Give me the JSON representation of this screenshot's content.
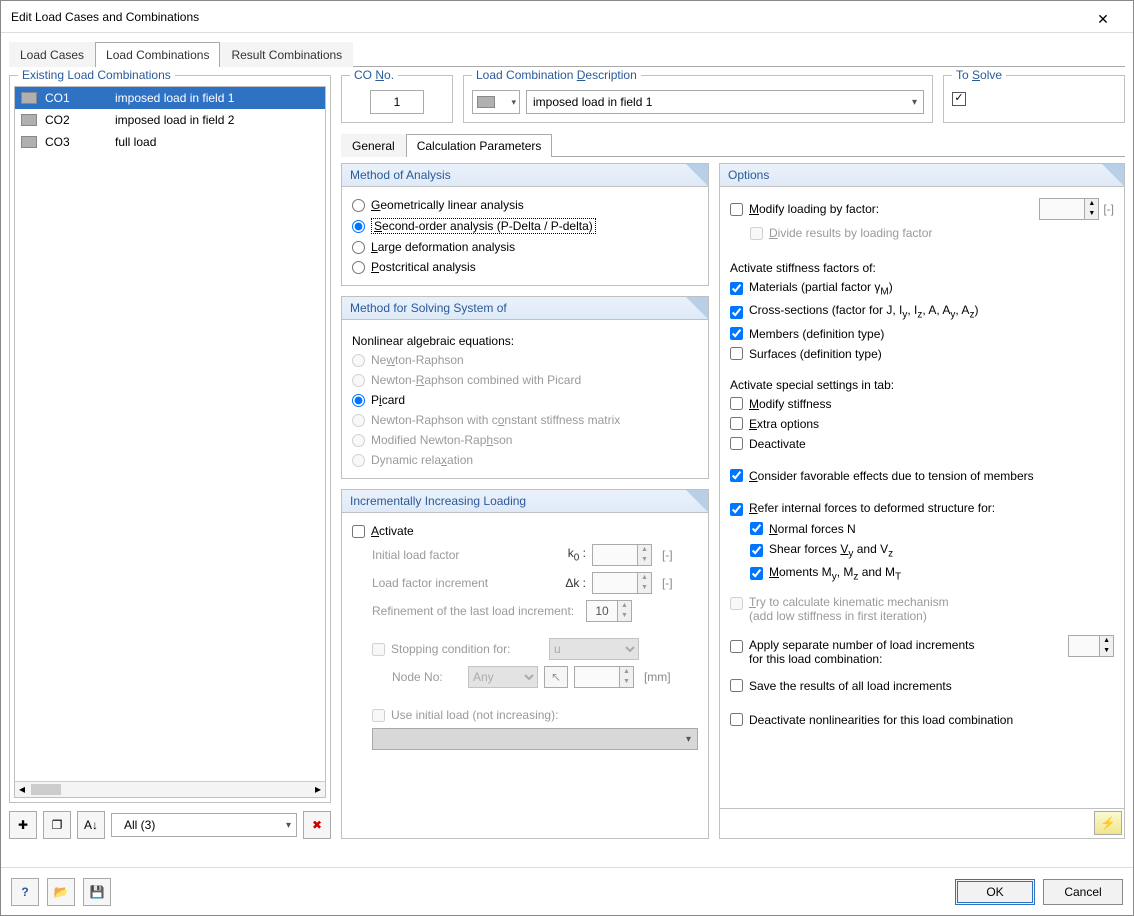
{
  "window": {
    "title": "Edit Load Cases and Combinations"
  },
  "tabs": {
    "loadCases": "Load Cases",
    "loadCombinations": "Load Combinations",
    "resultCombinations": "Result Combinations"
  },
  "leftPanel": {
    "title": "Existing Load Combinations",
    "rows": [
      {
        "co": "CO1",
        "desc": "imposed load in field 1",
        "selected": true
      },
      {
        "co": "CO2",
        "desc": "imposed load in field 2",
        "selected": false
      },
      {
        "co": "CO3",
        "desc": "full load",
        "selected": false
      }
    ],
    "filter": "All (3)"
  },
  "header": {
    "coNoLabel": "CO No.",
    "coNo": "1",
    "descLabel": "Load Combination Description",
    "descValue": "imposed load in field 1",
    "toSolveLabel": "To Solve",
    "toSolveChecked": true
  },
  "subtabs": {
    "general": "General",
    "calc": "Calculation Parameters"
  },
  "method": {
    "title": "Method of Analysis",
    "opt1": "Geometrically linear analysis",
    "opt2": "Second-order analysis (P-Delta / P-delta)",
    "opt3": "Large deformation analysis",
    "opt4": "Postcritical analysis"
  },
  "solver": {
    "title": "Method for Solving System of",
    "sub": "Nonlinear algebraic equations:",
    "o1": "Newton-Raphson",
    "o2": "Newton-Raphson combined with Picard",
    "o3": "Picard",
    "o4": "Newton-Raphson with constant stiffness matrix",
    "o5": "Modified Newton-Raphson",
    "o6": "Dynamic relaxation"
  },
  "inc": {
    "title": "Incrementally Increasing Loading",
    "activate": "Activate",
    "initial": "Initial load factor",
    "initialSym": "k0 :",
    "increment": "Load factor increment",
    "incrementSym": "Δk :",
    "refine": "Refinement of the last load increment:",
    "refineVal": "10",
    "stopCond": "Stopping condition for:",
    "stopVal": "u",
    "nodeNo": "Node No:",
    "nodeVal": "Any",
    "mm": "[mm]",
    "useInitial": "Use initial load (not increasing):"
  },
  "options": {
    "title": "Options",
    "modifyLoading": "Modify loading by factor:",
    "divide": "Divide results by loading factor",
    "activateStiff": "Activate stiffness factors of:",
    "materials": "Materials (partial factor γM)",
    "cross": "Cross-sections (factor for J, Iy, Iz, A, Ay, Az)",
    "members": "Members (definition type)",
    "surfaces": "Surfaces (definition type)",
    "activateSpecial": "Activate special settings in tab:",
    "modStiff": "Modify stiffness",
    "extra": "Extra options",
    "deact": "Deactivate",
    "favorable": "Consider favorable effects due to tension of members",
    "refer": "Refer internal forces to deformed structure for:",
    "normal": "Normal forces N",
    "shear": "Shear forces Vy and Vz",
    "moments": "Moments My, Mz and MT",
    "tryCalc": "Try to calculate kinematic mechanism (add low stiffness in first iteration)",
    "applySep": "Apply separate number of load increments for this load combination:",
    "save": "Save the results of all load increments",
    "deactNon": "Deactivate nonlinearities for this load combination"
  },
  "footer": {
    "ok": "OK",
    "cancel": "Cancel"
  }
}
